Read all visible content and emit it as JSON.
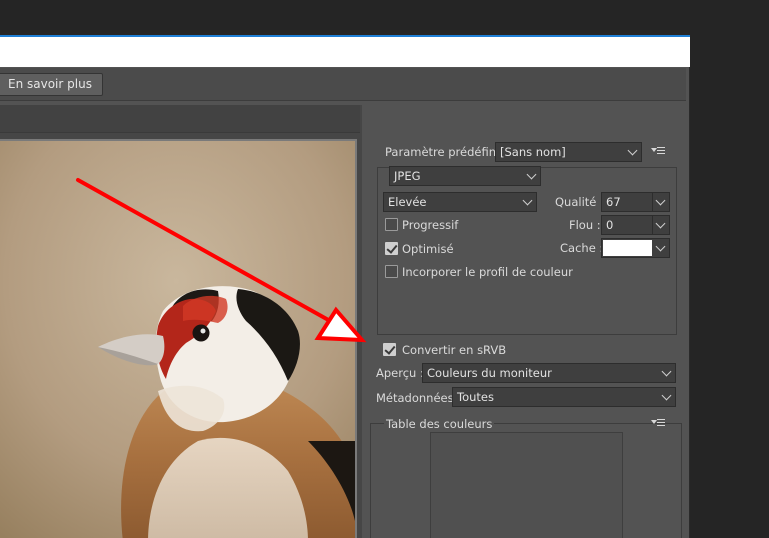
{
  "topbar": {
    "learn_more": "En savoir plus"
  },
  "preset": {
    "label": "Paramètre prédéfini :",
    "value": "[Sans nom]"
  },
  "format": {
    "value": "JPEG"
  },
  "quality_level": {
    "value": "Elevée"
  },
  "quality": {
    "label": "Qualité :",
    "value": "67"
  },
  "blur": {
    "label": "Flou :",
    "value": "0"
  },
  "matte": {
    "label": "Cache :"
  },
  "options": {
    "progressive": {
      "label": "Progressif",
      "checked": false
    },
    "optimized": {
      "label": "Optimisé",
      "checked": true
    },
    "embed_profile": {
      "label": "Incorporer le profil de couleur",
      "checked": false
    },
    "convert_srgb": {
      "label": "Convertir en sRVB",
      "checked": true
    }
  },
  "preview": {
    "label": "Aperçu :",
    "value": "Couleurs du moniteur"
  },
  "metadata": {
    "label": "Métadonnées :",
    "value": "Toutes"
  },
  "color_table": {
    "title": "Table des couleurs"
  },
  "icons": {
    "panel_menu": "panel-menu-icon",
    "annotation": "red-arrow"
  },
  "colors": {
    "arrow": "#ff0000",
    "background": "#535353",
    "dark": "#252525"
  }
}
